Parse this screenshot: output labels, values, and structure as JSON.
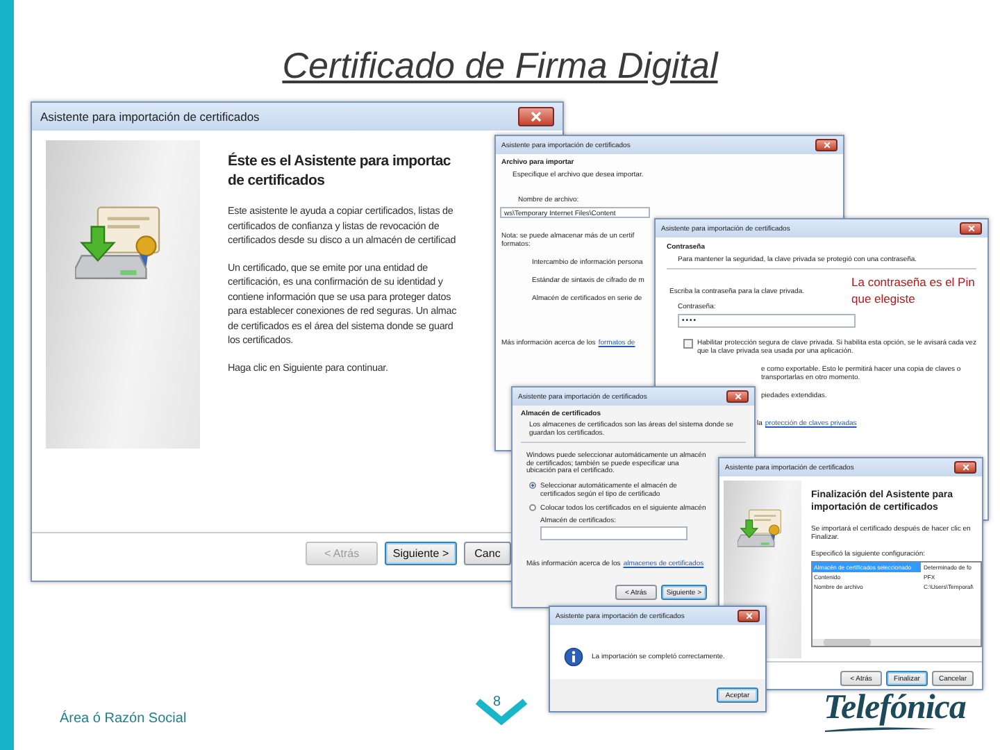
{
  "slide": {
    "title": "Certificado de Firma Digital",
    "footer": "Área ó Razón Social",
    "page_number": "8",
    "logo": "Telefónica"
  },
  "annotation": "La contraseña es el Pin que elegiste",
  "dialogs": [
    {
      "kind": "welcome",
      "title": "Asistente para importación de certificados",
      "heading_lines": [
        "Éste es el Asistente para importac",
        "de certificados"
      ],
      "paragraphs": [
        [
          "Este asistente le ayuda a copiar certificados, listas de",
          "certificados de confianza y listas de revocación de",
          "certificados desde su disco a un almacén de certificad"
        ],
        [
          "Un certificado, que se emite por una entidad de",
          "certificación, es una confirmación de su identidad y",
          "contiene información que se usa para proteger datos",
          "para establecer conexiones de red seguras. Un almac",
          "de certificados es el área del sistema donde se guard",
          "los certificados."
        ],
        [
          "Haga clic en Siguiente para continuar."
        ]
      ],
      "buttons": [
        {
          "label": "< Atrás",
          "disabled": true,
          "default": false
        },
        {
          "label": "Siguiente >",
          "disabled": false,
          "default": true
        },
        {
          "label": "Canc",
          "disabled": false,
          "default": false
        }
      ]
    },
    {
      "kind": "file",
      "title": "Asistente para importación de certificados",
      "section": "Archivo para importar",
      "subtitle": "Especifique el archivo que desea importar.",
      "filename_label": "Nombre de archivo:",
      "filename_value": "ws\\Temporary Internet Files\\Content",
      "note_lines": [
        "Nota: se puede almacenar más de un certif",
        "formatos:"
      ],
      "formats": [
        "Intercambio de información persona",
        "Estándar de sintaxis de cifrado de m",
        "Almacén de certificados en serie de"
      ],
      "more_text": "Más información acerca de los",
      "more_link": "formatos de"
    },
    {
      "kind": "password",
      "title": "Asistente para importación de certificados",
      "section": "Contraseña",
      "subtitle": "Para mantener la seguridad, la clave privada se protegió con una contraseña.",
      "prompt": "Escriba la contraseña para la clave privada.",
      "password_label": "Contraseña:",
      "password_value": "••••",
      "options": [
        {
          "kind": "checkbox",
          "label": "Habilitar protección segura de clave privada. Si habilita esta opción, se le avisará cada vez que la clave privada sea usada por una aplicación.",
          "checked": false
        },
        {
          "kind": "note",
          "label": "e como exportable. Esto le permitirá hacer una copia de claves o transportarlas en otro momento."
        },
        {
          "kind": "note",
          "label": "piedades extendidas."
        }
      ],
      "more_text": "la",
      "more_link": "protección de claves privadas"
    },
    {
      "kind": "store",
      "title": "Asistente para importación de certificados",
      "section": "Almacén de certificados",
      "subtitle": "Los almacenes de certificados son las áreas del sistema donde se guardan los certificados.",
      "intro": "Windows puede seleccionar automáticamente un almacén de certificados; también se puede especificar una ubicación para el certificado.",
      "radios": [
        {
          "label": "Seleccionar automáticamente el almacén de certificados según el tipo de certificado",
          "selected": true
        },
        {
          "label": "Colocar todos los certificados en el siguiente almacén",
          "selected": false
        }
      ],
      "store_label": "Almacén de certificados:",
      "more_text": "Más información acerca de los",
      "more_link": "almacenes de certificados",
      "buttons": [
        {
          "label": "< Atrás",
          "disabled": false,
          "default": false
        },
        {
          "label": "Siguiente >",
          "disabled": false,
          "default": true
        }
      ]
    },
    {
      "kind": "finish",
      "title": "Asistente para importación de certificados",
      "heading": "Finalización del Asistente para importación de certificados",
      "subtitle": "Se importará el certificado después de hacer clic en Finalizar.",
      "config_label": "Especificó la siguiente configuración:",
      "rows": [
        {
          "setting": "Almacén de certificados seleccionado",
          "value": "Determinado de fo",
          "selected": true
        },
        {
          "setting": "Contenido",
          "value": "PFX",
          "selected": false
        },
        {
          "setting": "Nombre de archivo",
          "value": "C:\\Users\\Temporal\\",
          "selected": false
        }
      ],
      "buttons": [
        {
          "label": "< Atrás",
          "disabled": false,
          "default": false
        },
        {
          "label": "Finalizar",
          "disabled": false,
          "default": true
        },
        {
          "label": "Cancelar",
          "disabled": false,
          "default": false
        }
      ]
    },
    {
      "kind": "message",
      "title": "Asistente para importación de certificados",
      "text": "La importación se completó correctamente.",
      "buttons": [
        {
          "label": "Aceptar",
          "disabled": false,
          "default": true
        }
      ]
    }
  ]
}
